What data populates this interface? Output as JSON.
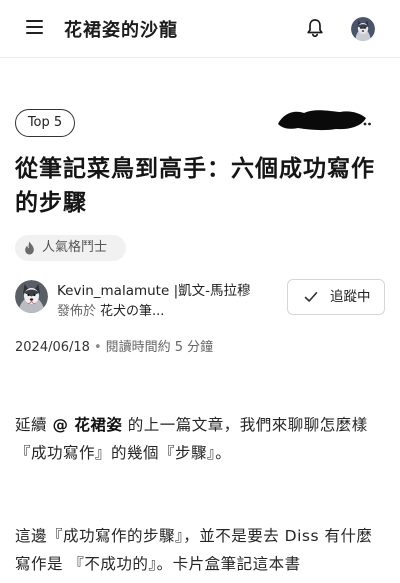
{
  "header": {
    "site_title": "花裙姿的沙龍",
    "menu_icon": "hamburger-menu-icon",
    "notification_icon": "bell-icon"
  },
  "article": {
    "rank_badge": "Top 5",
    "title": "從筆記菜鳥到高手：六個成功寫作的步驟",
    "role_badge": {
      "icon": "flame-icon",
      "label": "人氣格鬥士"
    },
    "author": {
      "name": "Kevin_malamute |凱文-馬拉穆",
      "published_label": "發佈於",
      "space_name": "花犬の筆..."
    },
    "follow_button": {
      "icon": "check-icon",
      "label": "追蹤中"
    },
    "date": "2024/06/18",
    "separator": "•",
    "read_time_label": "閱讀時間約 5 分鐘",
    "paragraphs": [
      {
        "prefix": "延續 ",
        "mention": "@ 花裙姿",
        "suffix": " 的上一篇文章，我們來聊聊怎麼樣 『成功寫作』的幾個『步驟』。"
      },
      {
        "text": "這邊『成功寫作的步驟』，並不是要去 Diss 有什麼寫作是 『不成功的』。卡片盒筆記這本書"
      }
    ]
  },
  "colors": {
    "text_primary": "#1f1f1f",
    "text_secondary": "#666666",
    "badge_bg": "#f1f1f1",
    "border": "#d6d6d6",
    "redaction": "#000000"
  }
}
